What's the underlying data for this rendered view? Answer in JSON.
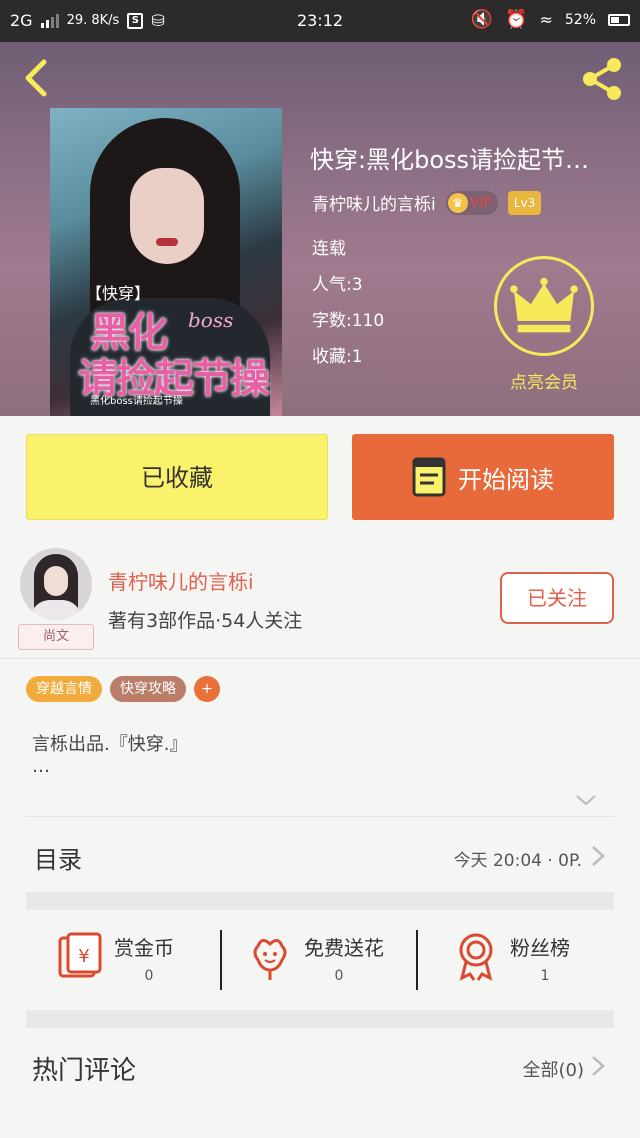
{
  "status_bar": {
    "network": "2G",
    "speed": "29. 8K/s",
    "time": "23:12",
    "battery": "52%"
  },
  "book": {
    "title": "快穿:黑化boss请捡起节…",
    "author": "青柠味儿的言栎i",
    "vip_label": "VIP",
    "level": "Lv3",
    "status": "连载",
    "popularity": "人气:3",
    "word_count": "字数:110",
    "favorites": "收藏:1"
  },
  "cover": {
    "tag": "【快穿】",
    "title_1": "黑化",
    "title_boss": "boss",
    "title_2": "请捡起节操",
    "subtitle": "黑化boss请捡起节操"
  },
  "member": {
    "label": "点亮会员"
  },
  "buttons": {
    "favorited": "已收藏",
    "start_reading": "开始阅读",
    "following": "已关注"
  },
  "author_card": {
    "name": "青柠味儿的言栎i",
    "stats": "著有3部作品·54人关注",
    "badge": "尚文"
  },
  "tags": [
    "穿越言情",
    "快穿攻略",
    "+"
  ],
  "description": {
    "line1": "言栎出品.『快穿.』",
    "line2": "…"
  },
  "toc": {
    "label": "目录",
    "update": "今天 20:04 · 0P."
  },
  "actions": [
    {
      "label": "赏金币",
      "count": "0"
    },
    {
      "label": "免费送花",
      "count": "0"
    },
    {
      "label": "粉丝榜",
      "count": "1"
    }
  ],
  "comments": {
    "label": "热门评论",
    "all": "全部(0)"
  },
  "colors": {
    "accent_orange": "#e86a3a",
    "fav_yellow": "#fbf26c",
    "author_red": "#e0604d",
    "member_yellow": "#f7ea5a"
  }
}
